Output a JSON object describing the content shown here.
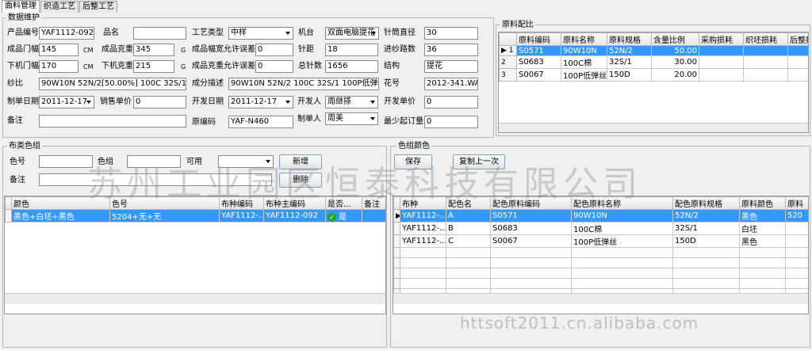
{
  "tabs": [
    "面料管理",
    "织造工艺",
    "后整工艺"
  ],
  "data_group": {
    "title": "数据维护",
    "fields": {
      "product_no_label": "产品编号",
      "product_no": "YAF1112-092",
      "pin_name_label": "品名",
      "pin_name": "",
      "craft_type_label": "工艺类型",
      "craft_type": "中样",
      "machine_label": "机台",
      "machine": "双面电脑提花",
      "needle_dia_label": "针筒直径",
      "needle_dia": "30",
      "width_label": "成品门幅",
      "width": "145",
      "cm1": "CM",
      "weight_label": "成品克重",
      "weight": "345",
      "g1": "G",
      "width_tol_label": "成品幅宽允许误差±",
      "width_tol": "0",
      "gauge_label": "针距",
      "gauge": "18",
      "feeders_label": "进纱路数",
      "feeders": "36",
      "off_width_label": "下机门幅",
      "off_width": "170",
      "cm2": "CM",
      "off_weight_label": "下机克重",
      "off_weight": "215",
      "g2": "G",
      "weight_tol_label": "成品克重允许误差±",
      "weight_tol": "0",
      "total_needles_label": "总针数",
      "total_needles": "1656",
      "structure_label": "结构",
      "structure": "提花",
      "yarn_label": "纱比",
      "yarn": "90W10N 52N/2[50.00%]  100C 32S/1[30.0",
      "comp_label": "成分描述",
      "comp": "90W10N 52N/2  100C 32S/1  100P低弹丝",
      "pattern_label": "花号",
      "pattern": "2012-341.WAC",
      "made_date_label": "制单日期",
      "made_date": "2011-12-17",
      "price_label": "销售单价",
      "price": "0",
      "dev_date_label": "开发日期",
      "dev_date": "2011-12-17",
      "developer_label": "开发人",
      "developer": "周继搽",
      "dev_price_label": "开发单价",
      "dev_price": "0",
      "remark_label": "备注",
      "remark": "",
      "orig_code_label": "原编码",
      "orig_code": "YAF-N460",
      "maker_label": "制单人",
      "maker": "周美",
      "min_order_label": "最少起订量",
      "min_order": "0"
    }
  },
  "ratio_group": {
    "title": "原料配比",
    "headers": [
      "原料编码",
      "原料名称",
      "原料规格",
      "含量比例",
      "采购损耗",
      "织坯损耗",
      "后整损"
    ],
    "rows": [
      {
        "ind": "▶ 1",
        "c": [
          "S0571",
          "90W10N",
          "52N/2",
          "50.00",
          "",
          "",
          ""
        ]
      },
      {
        "ind": "2",
        "c": [
          "S0683",
          "100C棉",
          "32S/1",
          "30.00",
          "",
          "",
          ""
        ]
      },
      {
        "ind": "3",
        "c": [
          "S0067",
          "100P低弹丝",
          "150D",
          "20.00",
          "",
          "",
          ""
        ]
      }
    ]
  },
  "color_group": {
    "title": "布类色组",
    "color_no_label": "色号",
    "color_no": "",
    "group_label": "色组",
    "group": "",
    "available_label": "可用",
    "available": "",
    "remark_label": "备注",
    "remark": "",
    "add_label": "新增",
    "delete_label": "删除",
    "headers": [
      "颜色",
      "色号",
      "布种编码",
      "布种主编码",
      "是否...",
      "备注"
    ],
    "rows": [
      {
        "c": [
          "黑色+白坯+黑色",
          "5204+无+无",
          "YAF1112-...",
          "YAF1112-092",
          "是",
          ""
        ]
      }
    ]
  },
  "group_color": {
    "title": "色组颜色",
    "save_label": "保存",
    "copy_label": "复制上一次",
    "headers": [
      "布种",
      "配色名",
      "配色原料编码",
      "配色原料名称",
      "配色原料规格",
      "原料颜色",
      "原料"
    ],
    "rows": [
      {
        "c": [
          "YAF1112-...",
          "A",
          "S0571",
          "90W10N",
          "52N/2",
          "黑色",
          "520"
        ]
      },
      {
        "c": [
          "YAF1112-...",
          "B",
          "S0683",
          "100C棉",
          "32S/1",
          "白坯",
          ""
        ]
      },
      {
        "c": [
          "YAF1112-...",
          "C",
          "S0067",
          "100P低弹丝",
          "150D",
          "黑色",
          ""
        ]
      }
    ]
  },
  "watermark_text": "苏州工业园区恒泰科技有限公司",
  "watermark_url": "httsoft2011.cn.alibaba.com"
}
